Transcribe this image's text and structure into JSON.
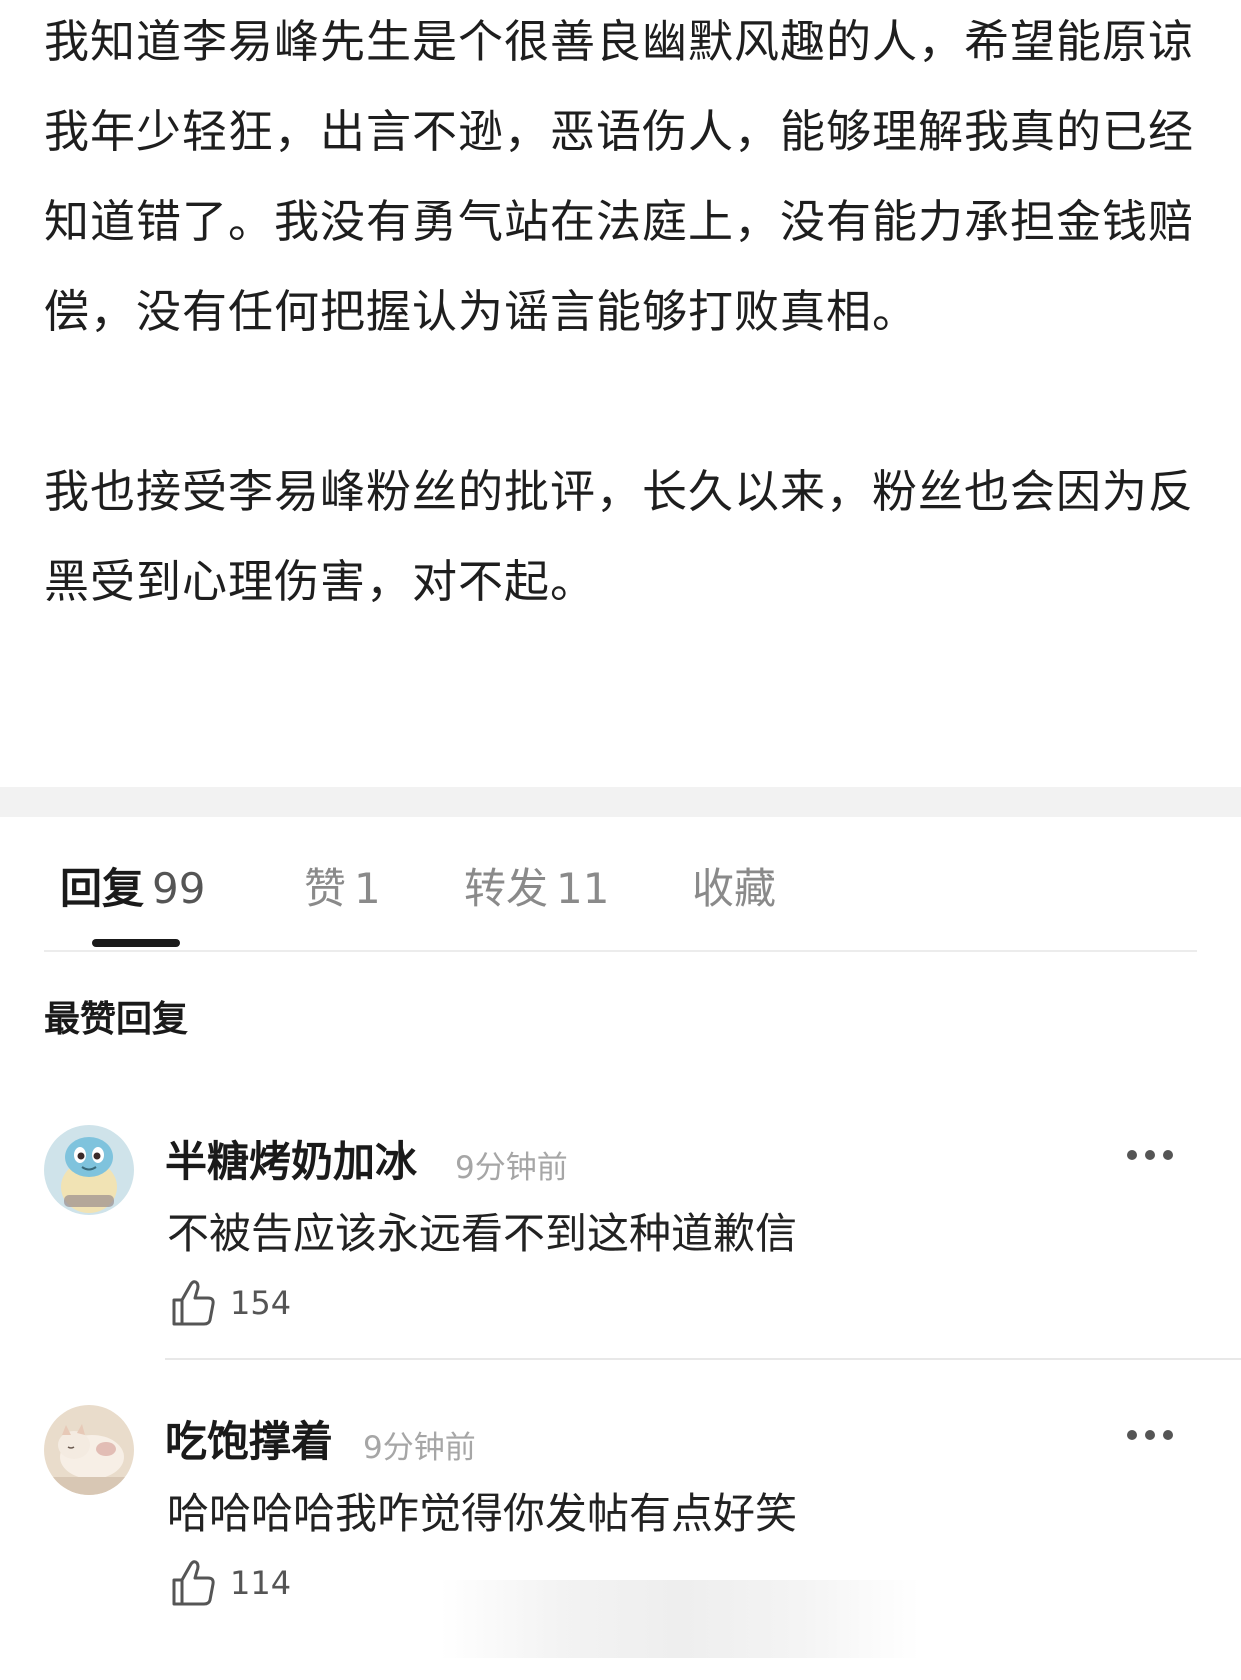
{
  "post": {
    "paragraphs": [
      "我知道李易峰先生是个很善良幽默风趣的人，希望能原谅我年少轻狂，出言不逊，恶语伤人，能够理解我真的已经知道错了。我没有勇气站在法庭上，没有能力承担金钱赔偿，没有任何把握认为谣言能够打败真相。",
      "我也接受李易峰粉丝的批评，长久以来，粉丝也会因为反黑受到心理伤害，对不起。"
    ]
  },
  "tabs": [
    {
      "label": "回复",
      "count": "99",
      "active": true
    },
    {
      "label": "赞",
      "count": "1",
      "active": false
    },
    {
      "label": "转发",
      "count": "11",
      "active": false
    },
    {
      "label": "收藏",
      "count": "",
      "active": false
    }
  ],
  "section_title": "最赞回复",
  "comments": [
    {
      "username": "半糖烤奶加冰",
      "time": "9分钟前",
      "text": "不被告应该永远看不到这种道歉信",
      "likes": "154",
      "avatar_icon": "squirtle-avatar"
    },
    {
      "username": "吃饱撑着",
      "time": "9分钟前",
      "text": "哈哈哈哈我咋觉得你发帖有点好笑",
      "likes": "114",
      "avatar_icon": "cat-avatar"
    }
  ],
  "icons": {
    "more": "more-dots-icon",
    "like": "thumbs-up-icon"
  },
  "colors": {
    "text_primary": "#1a1a1a",
    "text_secondary": "#8a8a8a",
    "divider": "#e8e8e8",
    "band": "#f2f2f2"
  }
}
